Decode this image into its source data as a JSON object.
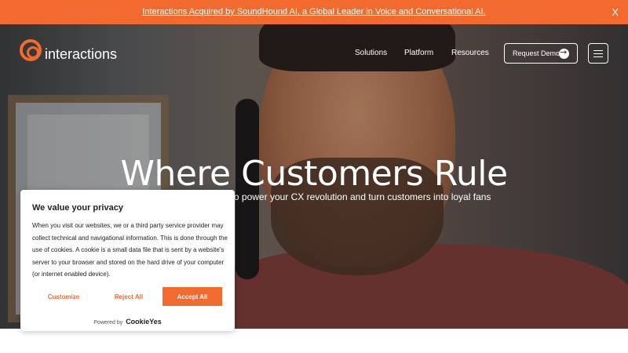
{
  "banner": {
    "text": "Interactions Acquired by SoundHound AI, a Global Leader in Voice and Conversational AI.",
    "close": "X"
  },
  "logo": {
    "text": "interactions"
  },
  "nav": {
    "items": [
      {
        "label": "Solutions"
      },
      {
        "label": "Platform"
      },
      {
        "label": "Resources"
      }
    ],
    "cta": "Request Demo"
  },
  "hero": {
    "title": "Where Customers Rule",
    "subtitle_visible": "to power your CX revolution and turn customers into loyal fans"
  },
  "cookie_banner": {
    "title": "We value your privacy",
    "body": "When you visit our websites, we or a third party service provider may collect technical and navigational information. This is done through the use of cookies. A cookie is a small data file that is sent by a website's server to your browser and stored on the hard drive of your computer (or internet enabled device).",
    "customize": "Customize",
    "reject": "Reject All",
    "accept": "Accept All",
    "powered_by": "Powered by",
    "brand": "CookieYes"
  },
  "colors": {
    "accent": "#f26a2e",
    "text_dark": "#212121",
    "white": "#ffffff"
  },
  "icons": [
    "close-icon",
    "arrow-right-icon",
    "hamburger-menu-icon"
  ]
}
